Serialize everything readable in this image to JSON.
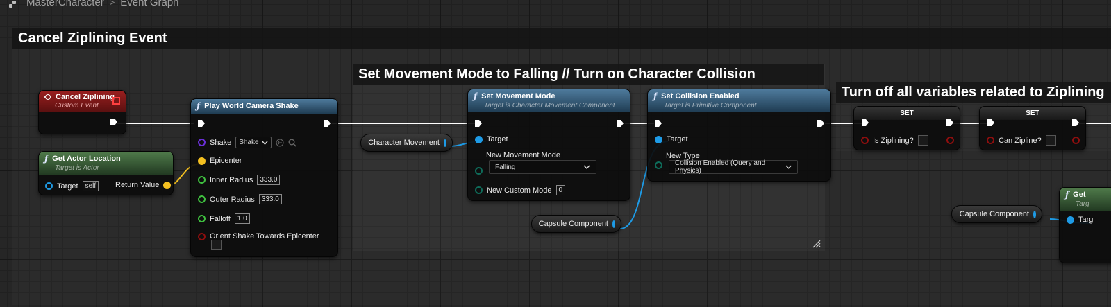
{
  "breadcrumb": {
    "root": "MasterCharacter",
    "separator": ">",
    "current": "Event Graph"
  },
  "comments": {
    "cancel_zip": "Cancel Ziplining Event",
    "movement": "Set Movement Mode to Falling // Turn on Character Collision",
    "turn_off": "Turn off all variables related to Ziplining"
  },
  "nodes": {
    "cancel_ziplining": {
      "title": "Cancel Ziplining",
      "subtitle": "Custom Event"
    },
    "get_actor_location": {
      "title": "Get Actor Location",
      "subtitle": "Target is Actor",
      "target_label": "Target",
      "target_value": "self",
      "return_label": "Return Value"
    },
    "play_shake": {
      "title": "Play World Camera Shake",
      "shake_label": "Shake",
      "shake_value": "Shake",
      "epicenter_label": "Epicenter",
      "inner_label": "Inner Radius",
      "inner_value": "333.0",
      "outer_label": "Outer Radius",
      "outer_value": "333.0",
      "falloff_label": "Falloff",
      "falloff_value": "1.0",
      "orient_label": "Orient Shake Towards Epicenter"
    },
    "char_movement": {
      "label": "Character Movement"
    },
    "set_movement_mode": {
      "title": "Set Movement Mode",
      "subtitle": "Target is Character Movement Component",
      "target_label": "Target",
      "new_mode_label": "New Movement Mode",
      "new_mode_value": "Falling",
      "custom_label": "New Custom Mode",
      "custom_value": "0"
    },
    "capsule_1": {
      "label": "Capsule Component"
    },
    "set_collision": {
      "title": "Set Collision Enabled",
      "subtitle": "Target is Primitive Component",
      "target_label": "Target",
      "new_type_label": "New Type",
      "new_type_value": "Collision Enabled (Query and Physics)"
    },
    "set_ziplining": {
      "title": "SET",
      "var_label": "Is Ziplining?"
    },
    "set_can_zipline": {
      "title": "SET",
      "var_label": "Can Zipline?"
    },
    "capsule_2": {
      "label": "Capsule Component"
    },
    "get_partial": {
      "title": "Get",
      "subtitle": "Targ",
      "target_label": "Targ"
    }
  },
  "colors": {
    "exec_wire": "#ffffff",
    "object_wire": "#1e9be6",
    "vector_wire": "#f4c020",
    "event_header": "#8e1b1b",
    "function_header": "#3d6a8c",
    "pure_header": "#4a7444",
    "bool_pin": "#8e0e0e",
    "float_pin": "#3fbf3f",
    "enum_pin": "#0e6c5a",
    "class_pin": "#6a2fd8"
  },
  "icons": [
    "graph-icon",
    "event-diamond-icon",
    "function-icon",
    "exec-pin-icon",
    "dropdown-chevron-icon",
    "reset-icon",
    "search-icon",
    "resize-grip-icon"
  ]
}
